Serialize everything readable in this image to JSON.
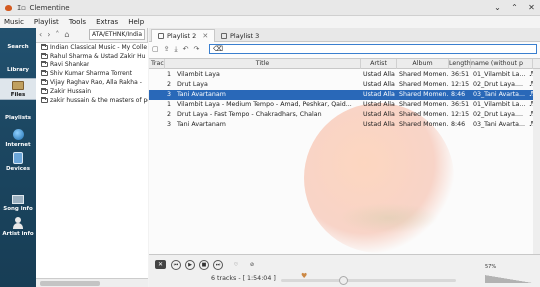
{
  "window": {
    "title": "Clementine",
    "mini_label": "I◻"
  },
  "menu": [
    "Music",
    "Playlist",
    "Tools",
    "Extras",
    "Help"
  ],
  "sidebar": {
    "tabs": [
      {
        "label": "Search",
        "icon": "search-icon"
      },
      {
        "label": "Library",
        "icon": "library-icon"
      },
      {
        "label": "Files",
        "icon": "folder-icon",
        "active": true
      },
      {
        "label": "Playlists",
        "icon": "playlists-icon"
      },
      {
        "label": "Internet",
        "icon": "globe-icon"
      },
      {
        "label": "Devices",
        "icon": "device-icon"
      },
      {
        "label": "Song info",
        "icon": "song-info-icon"
      },
      {
        "label": "Artist info",
        "icon": "artist-icon"
      }
    ]
  },
  "files": {
    "path": "ATA/ETHNK/India",
    "items": [
      "Indian Classical Music - My Colle",
      "Rahul Sharma & Ustad Zakir Hu",
      "Ravi Shankar",
      "Shiv Kumar Sharma Torrent",
      "Vijay Raghav Rao, Alla Rakha -",
      "Zakir Hussain",
      "zakir hussain & the masters of pe"
    ]
  },
  "playlist": {
    "tabs": [
      {
        "label": "Playlist 2",
        "active": true
      },
      {
        "label": "Playlist 3",
        "active": false
      }
    ],
    "columns": [
      "Trac",
      "Title",
      "Artist",
      "Album",
      "Length",
      "name (without p"
    ],
    "rows": [
      {
        "track": "1",
        "title": "Vilambit Laya",
        "artist": "Ustad Alla Rak...",
        "album": "Shared Momen...",
        "length": "36:51",
        "filename": "01_Vilambit La...",
        "playing": false
      },
      {
        "track": "2",
        "title": "Drut Laya",
        "artist": "Ustad Alla Rak...",
        "album": "Shared Momen...",
        "length": "12:15",
        "filename": "02_Drut Laya....",
        "playing": false
      },
      {
        "track": "3",
        "title": "Tani Avartanam",
        "artist": "Ustad Alla Rak...",
        "album": "Shared Momen...",
        "length": "8:46",
        "filename": "03_Tani Avarta...",
        "playing": true
      },
      {
        "track": "1",
        "title": "Vilambit Laya - Medium Tempo - Amad, Peshkar, Qaid...",
        "artist": "Ustad Alla Rak...",
        "album": "Shared Momen...",
        "length": "36:51",
        "filename": "01_Vilambit La...",
        "playing": false
      },
      {
        "track": "2",
        "title": "Drut Laya - Fast Tempo - Chakradhars, Chalan",
        "artist": "Ustad Alla Rak...",
        "album": "Shared Momen...",
        "length": "12:15",
        "filename": "02_Drut Laya....",
        "playing": false
      },
      {
        "track": "3",
        "title": "Tani Avartanam",
        "artist": "Ustad Alla Rak...",
        "album": "Shared Momen...",
        "length": "8:46",
        "filename": "03_Tani Avarta...",
        "playing": false
      }
    ]
  },
  "player": {
    "status": "6 tracks - [ 1:54:04 ]",
    "volume_label": "57%",
    "volume_level": 0.57,
    "position_fraction": 0.35
  },
  "colors": {
    "sidebar_bg": "#1c4762",
    "selection": "#2968b8",
    "accent": "#3a7fcf"
  }
}
